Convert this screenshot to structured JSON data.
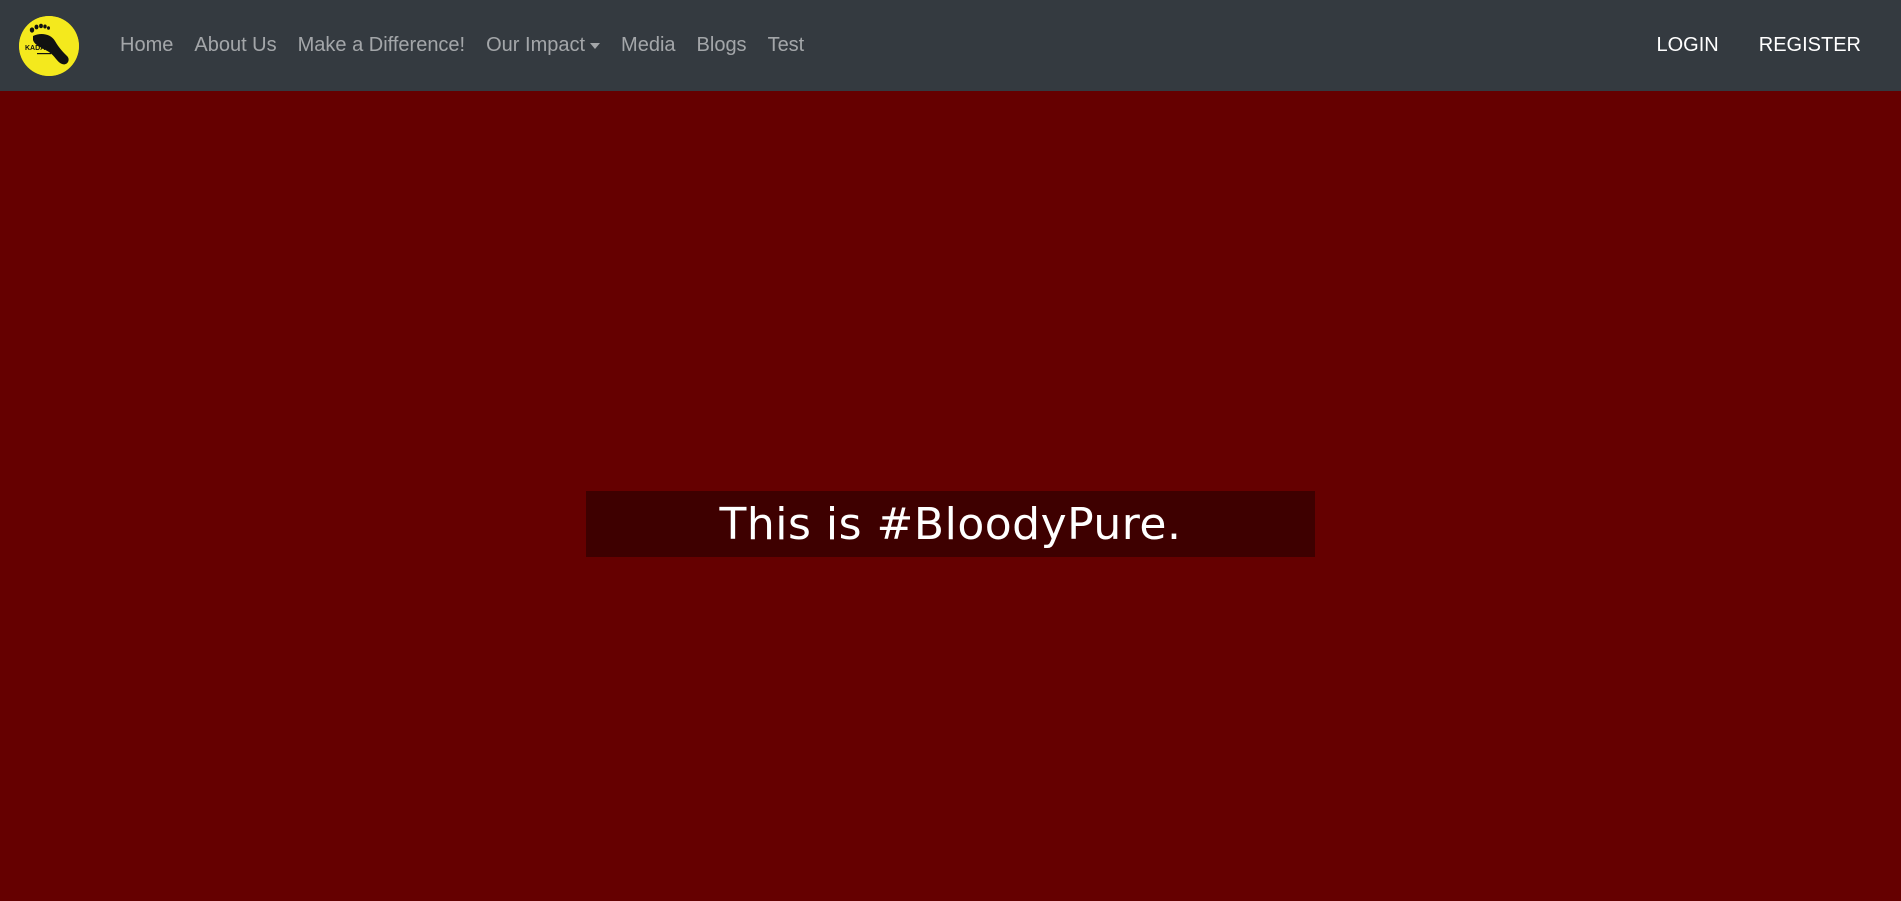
{
  "brand": {
    "logo_icon": "footprint-logo-icon",
    "logo_text": "KADAM",
    "logo_color": "#f4e91d"
  },
  "nav": {
    "items": [
      {
        "label": "Home"
      },
      {
        "label": "About Us"
      },
      {
        "label": "Make a Difference!"
      },
      {
        "label": "Our Impact",
        "dropdown": true
      },
      {
        "label": "Media"
      },
      {
        "label": "Blogs"
      },
      {
        "label": "Test"
      }
    ],
    "background": "#343a40"
  },
  "auth": {
    "login_label": "LOGIN",
    "register_label": "REGISTER"
  },
  "hero": {
    "tagline": "This is #BloodyPure.",
    "background": "#650000",
    "box_background": "#3e0000"
  }
}
